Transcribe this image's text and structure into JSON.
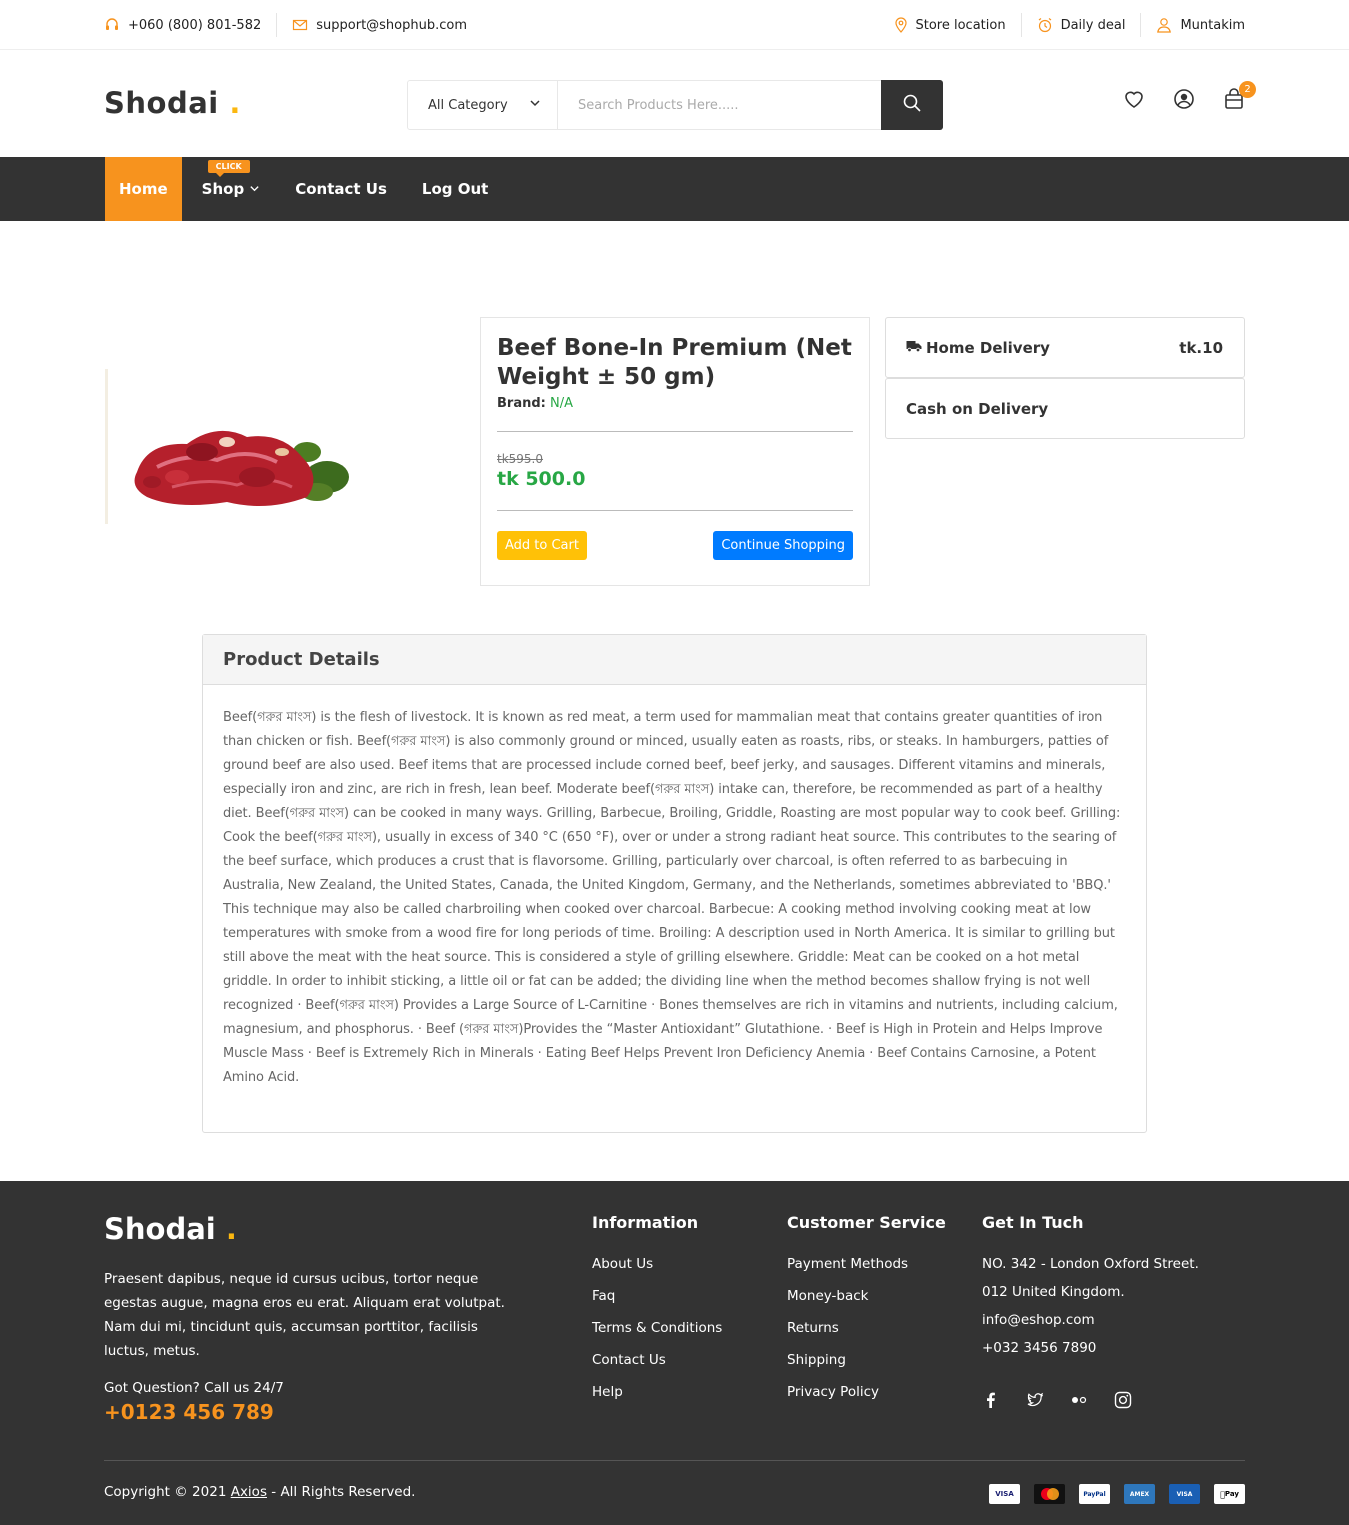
{
  "topbar": {
    "phone": "+060 (800) 801-582",
    "email": "support@shophub.com",
    "store_location": "Store location",
    "daily_deal": "Daily deal",
    "user": "Muntakim"
  },
  "header": {
    "logo": "Shodai",
    "logo_dot": ".",
    "category": "All Category",
    "search_placeholder": "Search Products Here.....",
    "cart_count": "2"
  },
  "nav": {
    "home": "Home",
    "shop": "Shop",
    "shop_badge": "CLICK",
    "contact": "Contact Us",
    "logout": "Log Out"
  },
  "product": {
    "title": "Beef Bone-In Premium (Net Weight ± 50 gm)",
    "brand_label": "Brand:",
    "brand_value": "N/A",
    "old_price": "tk595.0",
    "price": "tk 500.0",
    "add_to_cart": "Add to Cart",
    "continue_shopping": "Continue Shopping"
  },
  "delivery": {
    "home_label": "Home Delivery",
    "home_price": "tk.10",
    "cod_label": "Cash on Delivery"
  },
  "details": {
    "heading": "Product Details",
    "body": "Beef(গরুর মাংস) is the flesh of livestock. It is known as red meat, a term used for mammalian meat that contains greater quantities of iron than chicken or fish. Beef(গরুর মাংস) is also commonly ground or minced, usually eaten as roasts, ribs, or steaks. In hamburgers, patties of ground beef are also used. Beef items that are processed include corned beef, beef jerky, and sausages. Different vitamins and minerals, especially iron and zinc, are rich in fresh, lean beef. Moderate beef(গরুর মাংস) intake can, therefore, be recommended as part of a healthy diet. Beef(গরুর মাংস) can be cooked in many ways. Grilling, Barbecue, Broiling, Griddle, Roasting are most popular way to cook beef. Grilling: Cook the beef(গরুর মাংস), usually in excess of 340 °C (650 °F), over or under a strong radiant heat source. This contributes to the searing of the beef surface, which produces a crust that is flavorsome. Grilling, particularly over charcoal, is often referred to as barbecuing in Australia, New Zealand, the United States, Canada, the United Kingdom, Germany, and the Netherlands, sometimes abbreviated to 'BBQ.' This technique may also be called charbroiling when cooked over charcoal. Barbecue: A cooking method involving cooking meat at low temperatures with smoke from a wood fire for long periods of time. Broiling: A description used in North America. It is similar to grilling but still above the meat with the heat source. This is considered a style of grilling elsewhere. Griddle: Meat can be cooked on a hot metal griddle. In order to inhibit sticking, a little oil or fat can be added; the dividing line when the method becomes shallow frying is not well recognized · Beef(গরুর মাংস) Provides a Large Source of L-Carnitine · Bones themselves are rich in vitamins and nutrients, including calcium, magnesium, and phosphorus. · Beef (গরুর মাংস)Provides the “Master Antioxidant” Glutathione. · Beef is High in Protein and Helps Improve Muscle Mass · Beef is Extremely Rich in Minerals · Eating Beef Helps Prevent Iron Deficiency Anemia · Beef Contains Carnosine, a Potent Amino Acid."
  },
  "footer": {
    "logo": "Shodai",
    "logo_dot": ".",
    "about": "Praesent dapibus, neque id cursus ucibus, tortor neque egestas augue, magna eros eu erat. Aliquam erat volutpat. Nam dui mi, tincidunt quis, accumsan porttitor, facilisis luctus, metus.",
    "question": "Got Question? Call us 24/7",
    "phone": "+0123 456 789",
    "information": {
      "heading": "Information",
      "items": [
        "About Us",
        "Faq",
        "Terms & Conditions",
        "Contact Us",
        "Help"
      ]
    },
    "customer_service": {
      "heading": "Customer Service",
      "items": [
        "Payment Methods",
        "Money-back",
        "Returns",
        "Shipping",
        "Privacy Policy"
      ]
    },
    "get_in_touch": {
      "heading": "Get In Tuch",
      "items": [
        "NO. 342 - London Oxford Street.",
        "012 United Kingdom.",
        "info@eshop.com",
        "+032 3456 7890"
      ]
    },
    "copyright_prefix": "Copyright © 2021",
    "copyright_link": "Axios",
    "copyright_suffix": "- All Rights Reserved.",
    "payments": [
      "VISA",
      "mastercard",
      "PayPal",
      "AMEX",
      "VISA Electron",
      "Pay"
    ]
  },
  "colors": {
    "accent": "#f7931e",
    "logo_dot": "#fbb710",
    "dark": "#333333",
    "green": "#28a745",
    "blue": "#007bff",
    "yellow": "#ffc107"
  }
}
